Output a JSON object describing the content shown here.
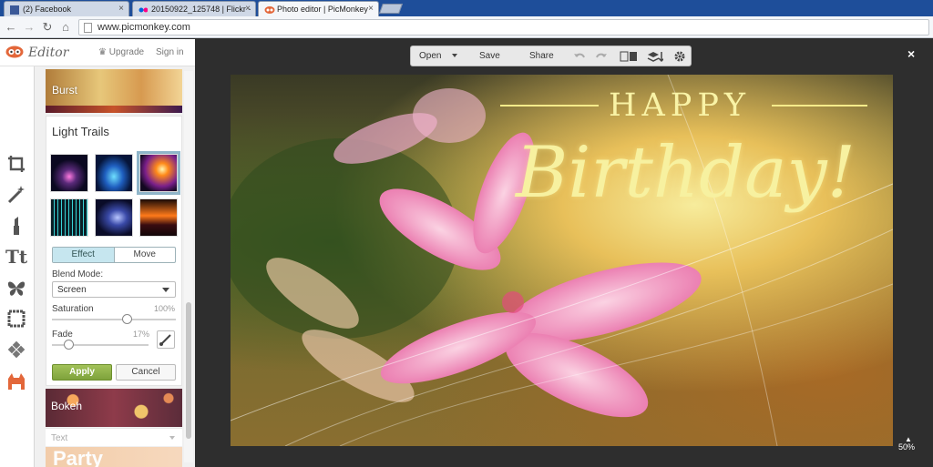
{
  "browser": {
    "tabs": [
      {
        "title": "(2) Facebook",
        "active": false
      },
      {
        "title": "20150922_125748 | Flickr -",
        "active": false
      },
      {
        "title": "Photo editor | PicMonkey",
        "active": true
      }
    ],
    "tab_close": "×",
    "url": "www.picmonkey.com"
  },
  "header": {
    "logo_text": "Editor",
    "upgrade": "Upgrade",
    "sign_in": "Sign in"
  },
  "tools": [
    "crop-icon",
    "magic-wand-icon",
    "lipstick-icon",
    "text-icon",
    "butterfly-icon",
    "frame-icon",
    "texture-icon",
    "monkey-icon"
  ],
  "text_tool_glyph": "Tt",
  "panel": {
    "burst_label": "Burst",
    "card_title": "Light Trails",
    "mode_tabs": [
      "Effect",
      "Move"
    ],
    "blend_mode_label": "Blend Mode:",
    "blend_mode_value": "Screen",
    "saturation_label": "Saturation",
    "saturation_value": "100%",
    "saturation_level": 0.6,
    "fade_label": "Fade",
    "fade_value": "17%",
    "fade_level": 0.17,
    "apply": "Apply",
    "cancel": "Cancel",
    "bokeh_label": "Bokeh",
    "text_dropdown": "Text",
    "party_label": "Party"
  },
  "toolbar": {
    "open": "Open",
    "save": "Save",
    "share": "Share"
  },
  "canvas": {
    "happy": "HAPPY",
    "birthday": "Birthday!",
    "zoom": "50%",
    "close": "×"
  },
  "colors": {
    "accent_green": "#8ab14a",
    "rail_orange": "#e3673a",
    "tab_bar": "#1e4e9a"
  }
}
